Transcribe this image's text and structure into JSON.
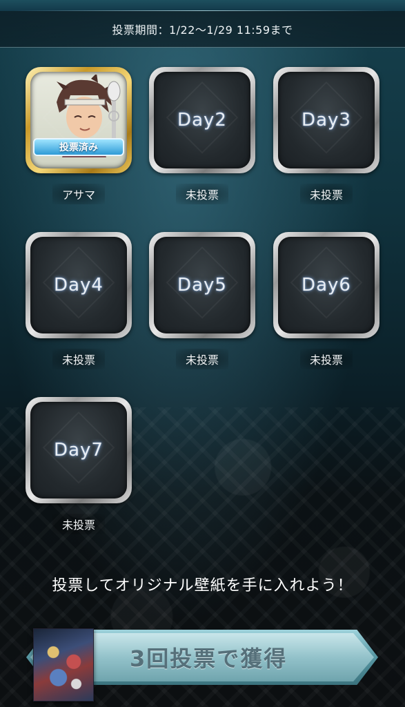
{
  "header": {
    "period_text": "投票期間：1/22〜1/29 11:59まで"
  },
  "tiles": [
    {
      "label": "",
      "caption": "アサマ",
      "voted": true,
      "badge": "投票済み"
    },
    {
      "label": "Day2",
      "caption": "未投票",
      "voted": false
    },
    {
      "label": "Day3",
      "caption": "未投票",
      "voted": false
    },
    {
      "label": "Day4",
      "caption": "未投票",
      "voted": false
    },
    {
      "label": "Day5",
      "caption": "未投票",
      "voted": false
    },
    {
      "label": "Day6",
      "caption": "未投票",
      "voted": false
    },
    {
      "label": "Day7",
      "caption": "未投票",
      "voted": false
    }
  ],
  "message": "投票してオリジナル壁紙を手に入れよう！",
  "reward": {
    "label": "3回投票で獲得"
  },
  "colors": {
    "accent_teal": "#2e9bd6",
    "gold_frame": "#c99a2a",
    "silver_frame": "#9a9a9a"
  }
}
